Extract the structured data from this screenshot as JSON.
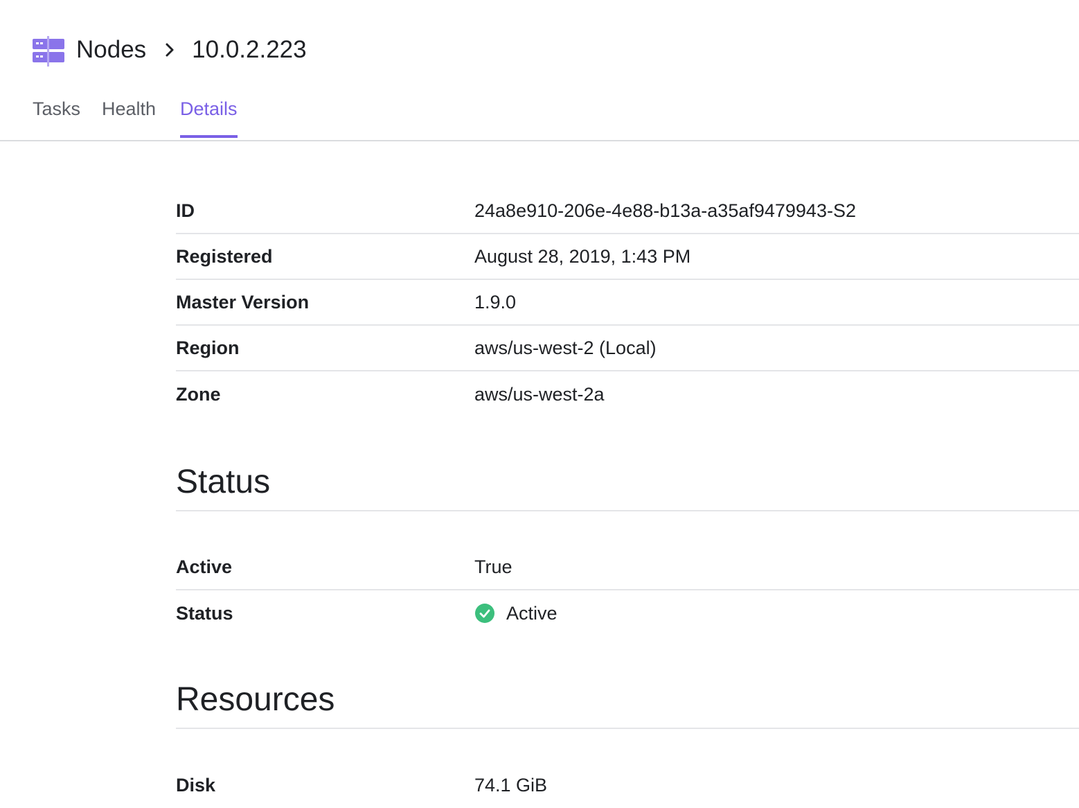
{
  "header": {
    "icon": "nodes-icon",
    "breadcrumb_root": "Nodes",
    "breadcrumb_current": "10.0.2.223"
  },
  "tabs": [
    {
      "label": "Tasks",
      "active": false
    },
    {
      "label": "Health",
      "active": false
    },
    {
      "label": "Details",
      "active": true
    }
  ],
  "details": [
    {
      "label": "ID",
      "value": "24a8e910-206e-4e88-b13a-a35af9479943-S2"
    },
    {
      "label": "Registered",
      "value": "August 28, 2019, 1:43 PM"
    },
    {
      "label": "Master Version",
      "value": "1.9.0"
    },
    {
      "label": "Region",
      "value": "aws/us-west-2 (Local)"
    },
    {
      "label": "Zone",
      "value": "aws/us-west-2a"
    }
  ],
  "status_section": {
    "title": "Status",
    "rows": [
      {
        "label": "Active",
        "value": "True"
      },
      {
        "label": "Status",
        "value": "Active",
        "icon": "check-circle-icon"
      }
    ]
  },
  "resources_section": {
    "title": "Resources",
    "rows": [
      {
        "label": "Disk",
        "value": "74.1 GiB"
      }
    ]
  },
  "colors": {
    "accent": "#7a60e6",
    "success": "#3cbf7d",
    "text": "#1f2125",
    "muted": "#5c5f66",
    "divider": "#e4e5e8"
  }
}
